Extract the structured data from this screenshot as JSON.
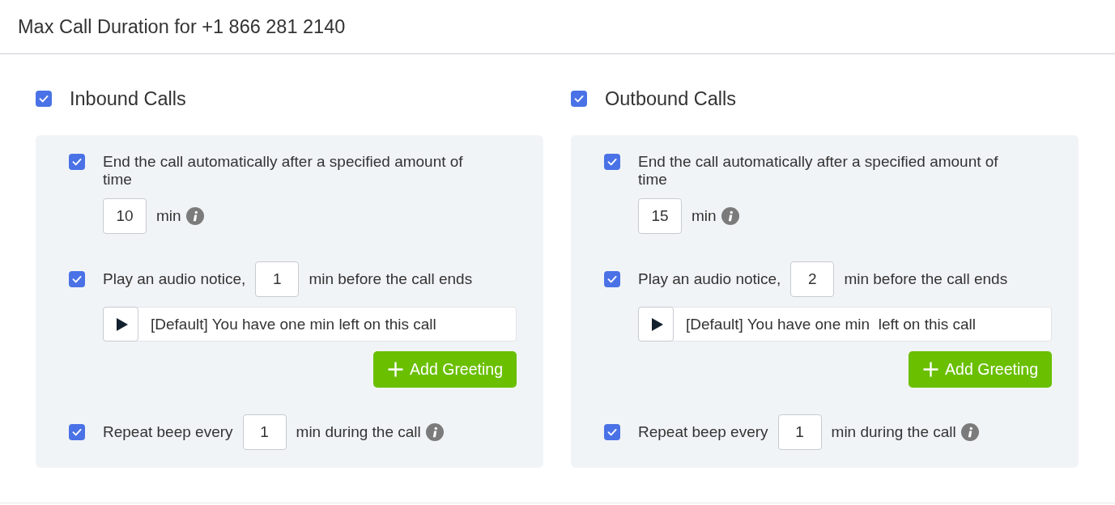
{
  "header": {
    "title": "Max Call Duration for +1 866 281 2140"
  },
  "sections": [
    {
      "title": "Inbound Calls",
      "checked": true,
      "options": [
        {
          "kind": "duration",
          "checked": true,
          "label": "End the call automatically after a specified amount of time",
          "value": "10",
          "unit": "min"
        },
        {
          "kind": "notice",
          "checked": true,
          "label": "Play an audio notice,",
          "value": "1",
          "suffix": "min before the call ends",
          "greeting": "[Default] You have one min left on this call",
          "button": "Add Greeting"
        },
        {
          "kind": "beep",
          "checked": true,
          "label": "Repeat beep every",
          "value": "1",
          "suffix": "min during the call"
        }
      ]
    },
    {
      "title": "Outbound Calls",
      "checked": true,
      "options": [
        {
          "kind": "duration",
          "checked": true,
          "label": "End the call automatically after a specified amount of time",
          "value": "15",
          "unit": "min"
        },
        {
          "kind": "notice",
          "checked": true,
          "label": "Play an audio notice,",
          "value": "2",
          "suffix": "min before the call ends",
          "greeting": "[Default] You have one min  left on this call",
          "button": "Add Greeting"
        },
        {
          "kind": "beep",
          "checked": true,
          "label": "Repeat beep every",
          "value": "1",
          "suffix": "min during the call"
        }
      ]
    }
  ]
}
